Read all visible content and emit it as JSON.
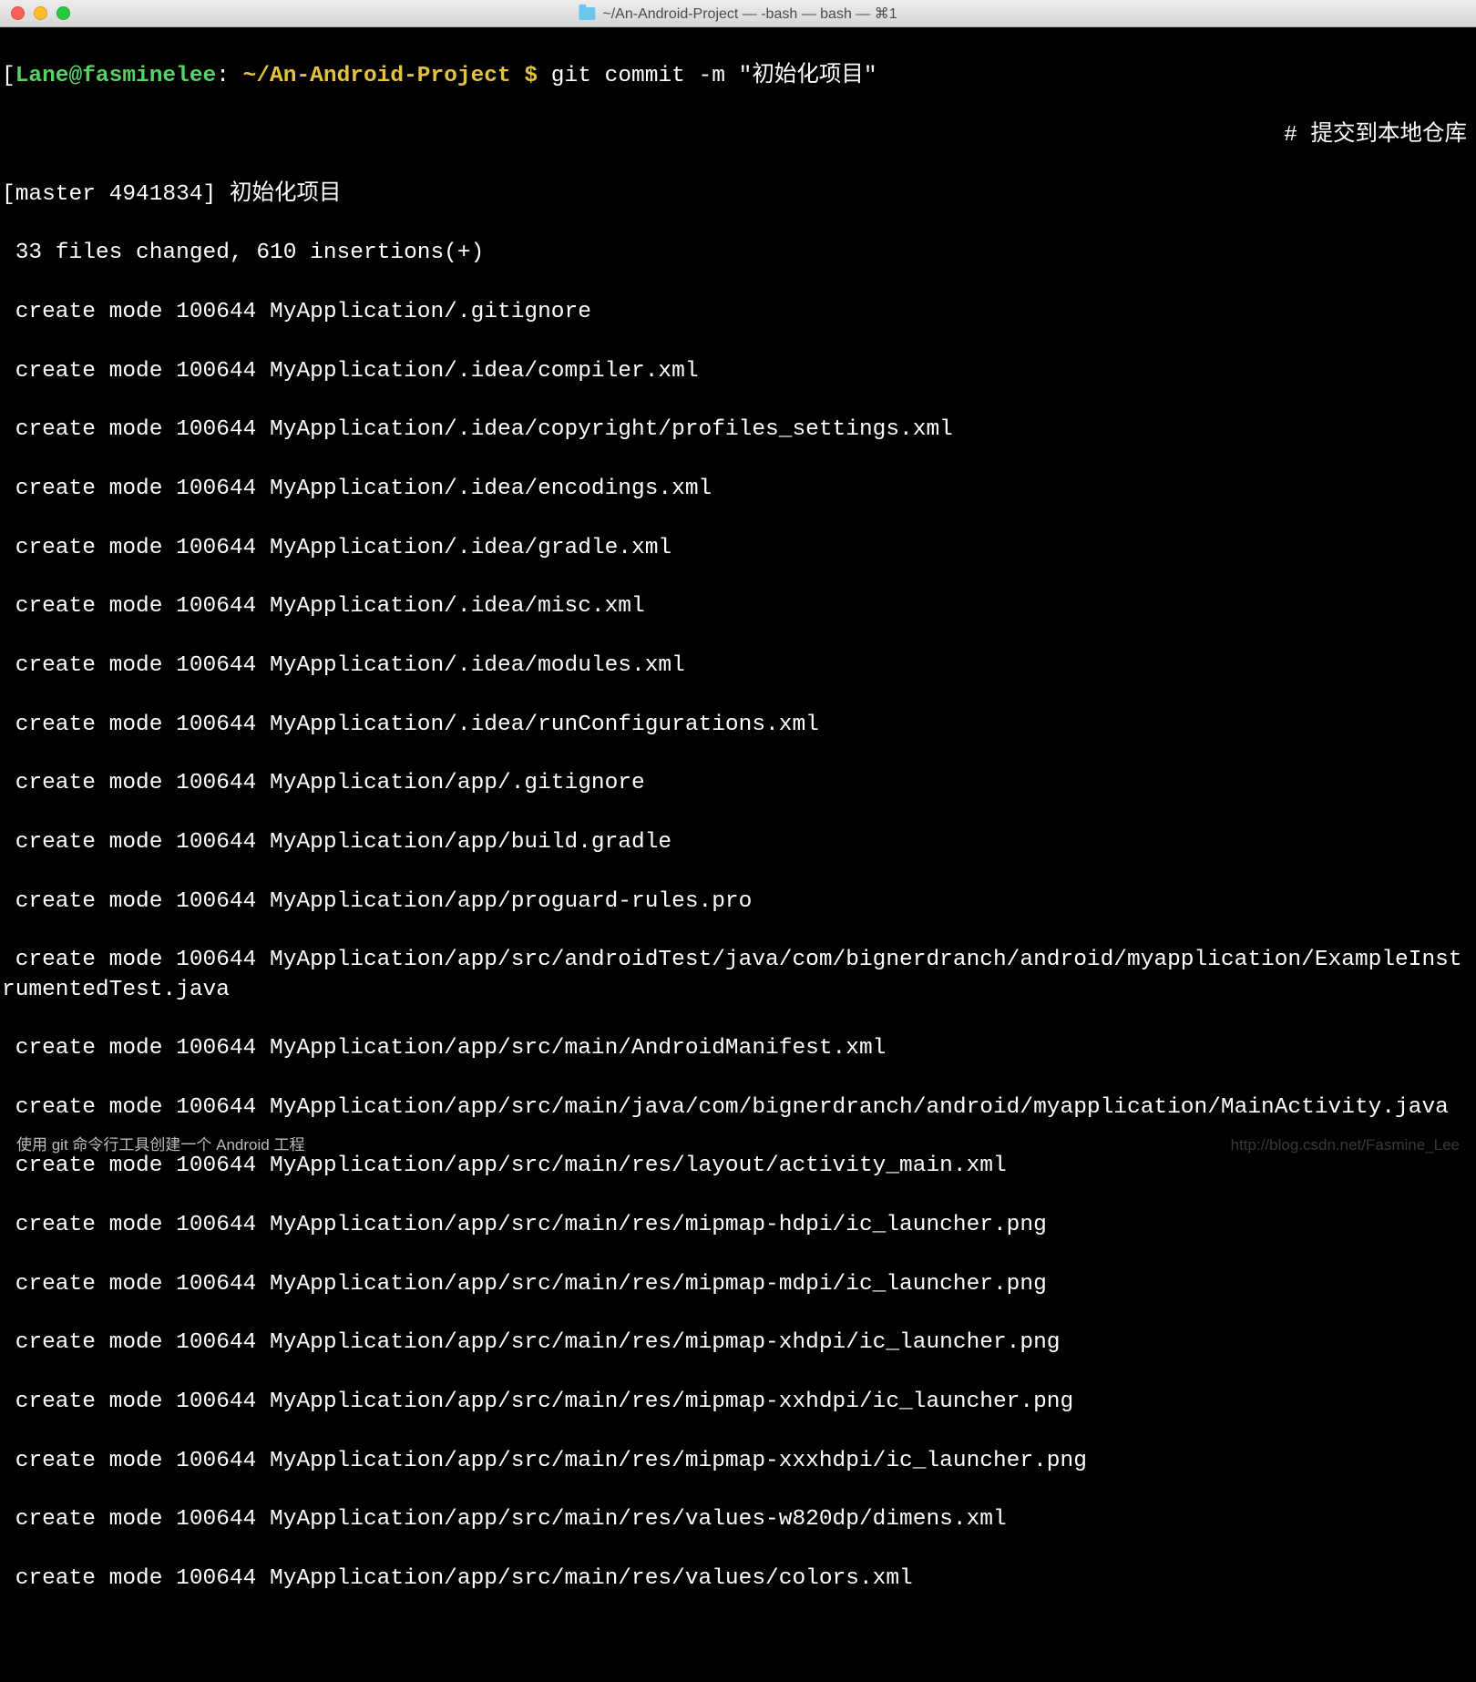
{
  "titlebar": {
    "title": "~/An-Android-Project — -bash — bash — ⌘1"
  },
  "prompt": {
    "open_bracket": "[",
    "user_host": "Lane@fasminelee",
    "colon": ":",
    "path": " ~/An-Android-Project $",
    "command": " git commit -m \"初始化项目\"",
    "close_bracket": "]"
  },
  "comment": "# 提交到本地仓库",
  "commit_header": "[master 4941834] 初始化项目",
  "summary": " 33 files changed, 610 insertions(+)",
  "files": [
    " create mode 100644 MyApplication/.gitignore",
    " create mode 100644 MyApplication/.idea/compiler.xml",
    " create mode 100644 MyApplication/.idea/copyright/profiles_settings.xml",
    " create mode 100644 MyApplication/.idea/encodings.xml",
    " create mode 100644 MyApplication/.idea/gradle.xml",
    " create mode 100644 MyApplication/.idea/misc.xml",
    " create mode 100644 MyApplication/.idea/modules.xml",
    " create mode 100644 MyApplication/.idea/runConfigurations.xml",
    " create mode 100644 MyApplication/app/.gitignore",
    " create mode 100644 MyApplication/app/build.gradle",
    " create mode 100644 MyApplication/app/proguard-rules.pro",
    " create mode 100644 MyApplication/app/src/androidTest/java/com/bignerdranch/android/myapplication/ExampleInstrumentedTest.java",
    " create mode 100644 MyApplication/app/src/main/AndroidManifest.xml",
    " create mode 100644 MyApplication/app/src/main/java/com/bignerdranch/android/myapplication/MainActivity.java",
    " create mode 100644 MyApplication/app/src/main/res/layout/activity_main.xml",
    " create mode 100644 MyApplication/app/src/main/res/mipmap-hdpi/ic_launcher.png",
    " create mode 100644 MyApplication/app/src/main/res/mipmap-mdpi/ic_launcher.png",
    " create mode 100644 MyApplication/app/src/main/res/mipmap-xhdpi/ic_launcher.png",
    " create mode 100644 MyApplication/app/src/main/res/mipmap-xxhdpi/ic_launcher.png",
    " create mode 100644 MyApplication/app/src/main/res/mipmap-xxxhdpi/ic_launcher.png",
    " create mode 100644 MyApplication/app/src/main/res/values-w820dp/dimens.xml",
    " create mode 100644 MyApplication/app/src/main/res/values/colors.xml"
  ],
  "caption": "使用 git 命令行工具创建一个 Android 工程",
  "watermark": "http://blog.csdn.net/Fasmine_Lee"
}
